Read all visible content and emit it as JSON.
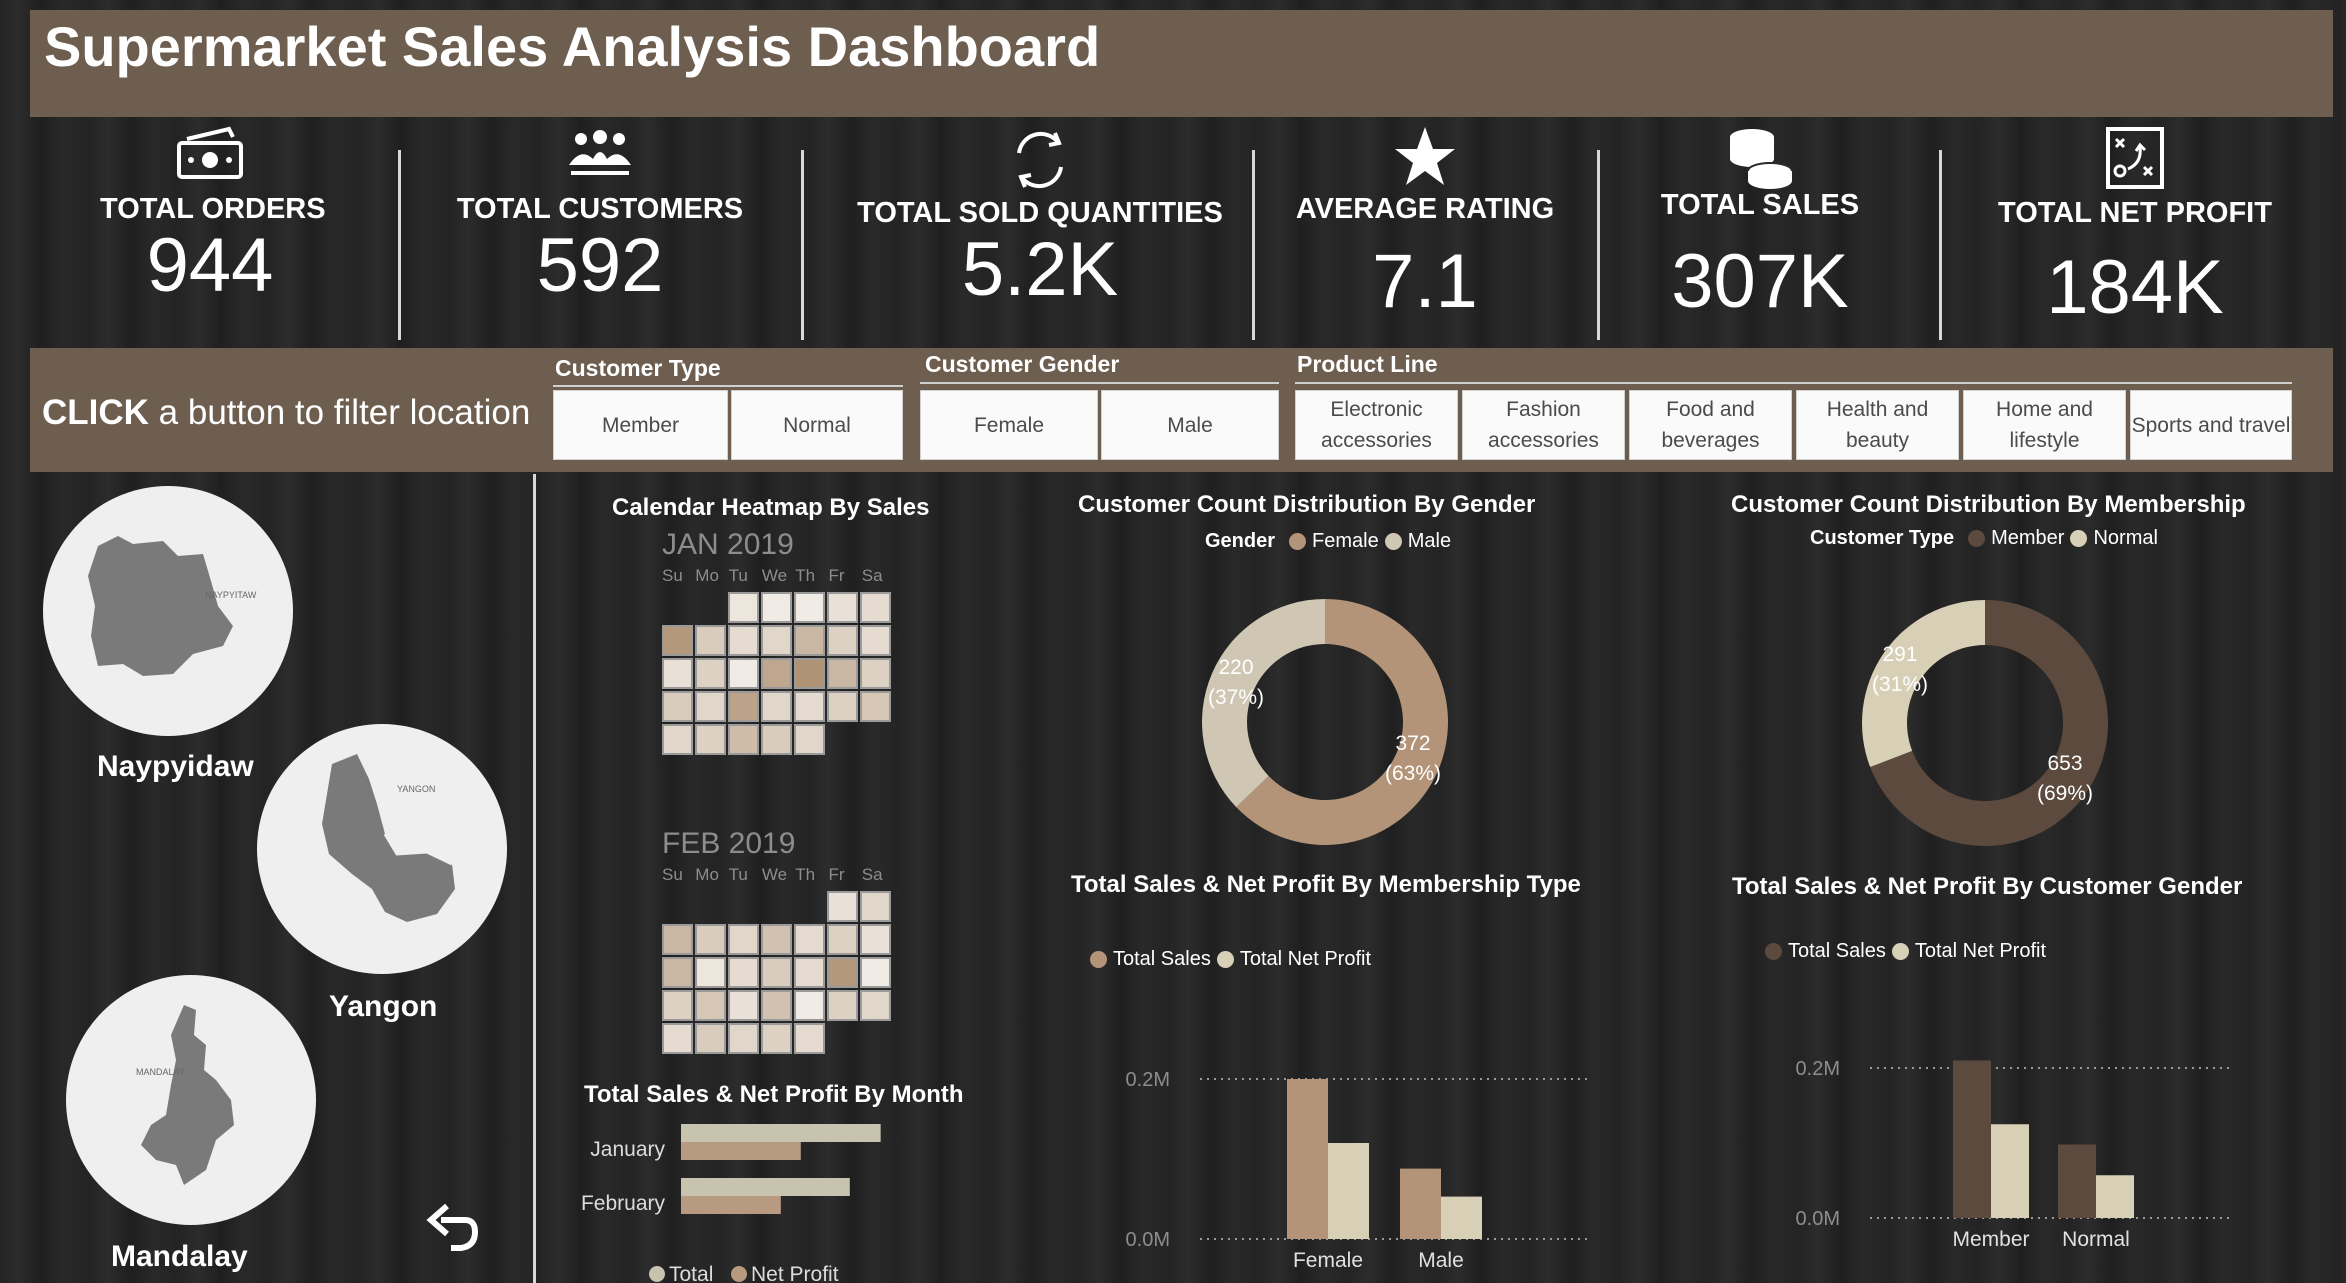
{
  "header": {
    "title": "Supermarket Sales Analysis Dashboard"
  },
  "kpis": [
    {
      "label": "TOTAL ORDERS",
      "value": "944",
      "icon": "cash-icon"
    },
    {
      "label": "TOTAL CUSTOMERS",
      "value": "592",
      "icon": "group-icon"
    },
    {
      "label": "TOTAL SOLD QUANTITIES",
      "value": "5.2K",
      "icon": "refresh-icon"
    },
    {
      "label": "AVERAGE RATING",
      "value": "7.1",
      "icon": "star-icon"
    },
    {
      "label": "TOTAL SALES",
      "value": "307K",
      "icon": "coins-icon"
    },
    {
      "label": "TOTAL NET PROFIT",
      "value": "184K",
      "icon": "strategy-icon"
    }
  ],
  "filters": {
    "click_bold": "CLICK",
    "click_rest": " a button to filter location",
    "customer_type": {
      "title": "Customer Type",
      "options": [
        "Member",
        "Normal"
      ]
    },
    "customer_gender": {
      "title": "Customer Gender",
      "options": [
        "Female",
        "Male"
      ]
    },
    "product_line": {
      "title": "Product Line",
      "options": [
        "Electronic accessories",
        "Fashion accessories",
        "Food and beverages",
        "Health and beauty",
        "Home and lifestyle",
        "Sports and travel"
      ]
    }
  },
  "locations": [
    {
      "name": "Naypyidaw",
      "map_label": "NAYPYITAW"
    },
    {
      "name": "Yangon",
      "map_label": "YANGON"
    },
    {
      "name": "Mandalay",
      "map_label": "MANDALAY"
    }
  ],
  "calendar": {
    "title": "Calendar Heatmap By Sales",
    "days_of_week": [
      "Su",
      "Mo",
      "Tu",
      "We",
      "Th",
      "Fr",
      "Sa"
    ],
    "months": [
      {
        "label": "JAN 2019",
        "start_weekday": 2,
        "days": 31,
        "intensity": [
          0.1,
          0.05,
          0.05,
          0.15,
          0.2,
          0.85,
          0.35,
          0.2,
          0.25,
          0.55,
          0.3,
          0.2,
          0.15,
          0.3,
          0.05,
          0.7,
          0.9,
          0.55,
          0.3,
          0.35,
          0.25,
          0.75,
          0.25,
          0.2,
          0.3,
          0.4,
          0.25,
          0.3,
          0.5,
          0.35,
          0.25
        ]
      },
      {
        "label": "FEB 2019",
        "start_weekday": 5,
        "days": 28,
        "intensity": [
          0.15,
          0.25,
          0.55,
          0.35,
          0.25,
          0.45,
          0.2,
          0.3,
          0.15,
          0.55,
          0.1,
          0.2,
          0.35,
          0.2,
          0.85,
          0.05,
          0.3,
          0.4,
          0.15,
          0.45,
          0.05,
          0.3,
          0.25,
          0.2,
          0.35,
          0.25,
          0.3,
          0.2
        ]
      }
    ]
  },
  "colors": {
    "member": "#5b4a3d",
    "normal": "#d8cfb7",
    "female": "#b39478",
    "male": "#cfc6b3",
    "total_sales_light": "#c7c3ae",
    "net_profit_tan": "#b89a80"
  },
  "chart_data": [
    {
      "type": "pie",
      "title": "Customer Count Distribution By Gender",
      "legend_title": "Gender",
      "categories": [
        "Female",
        "Male"
      ],
      "values": [
        372,
        220
      ],
      "labels": [
        "372 (63%)",
        "220 (37%)"
      ],
      "colors": [
        "#b39478",
        "#cfc6b3"
      ]
    },
    {
      "type": "pie",
      "title": "Customer Count Distribution By Membership",
      "legend_title": "Customer Type",
      "categories": [
        "Member",
        "Normal"
      ],
      "values": [
        653,
        291
      ],
      "labels": [
        "653 (69%)",
        "291 (31%)"
      ],
      "colors": [
        "#5b4a3d",
        "#d8cfb7"
      ]
    },
    {
      "type": "bar",
      "orientation": "horizontal",
      "title": "Total Sales & Net Profit By Month",
      "categories": [
        "January",
        "February"
      ],
      "series": [
        {
          "name": "Total",
          "values": [
            110000,
            93000
          ],
          "color": "#c7c3ae"
        },
        {
          "name": "Net Profit",
          "values": [
            66000,
            55000
          ],
          "color": "#b89a80"
        }
      ],
      "xlim": [
        0,
        200000
      ]
    },
    {
      "type": "bar",
      "title": "Total Sales & Net Profit By Membership Type",
      "categories": [
        "Female",
        "Male"
      ],
      "series": [
        {
          "name": "Total Sales",
          "values": [
            200000,
            88000
          ],
          "color": "#b39478"
        },
        {
          "name": "Total Net Profit",
          "values": [
            120000,
            53000
          ],
          "color": "#d8cfb7"
        }
      ],
      "ylim": [
        0,
        0.2
      ],
      "yticks": [
        "0.0M",
        "0.2M"
      ]
    },
    {
      "type": "bar",
      "title": "Total Sales & Net Profit By Customer Gender",
      "categories": [
        "Member",
        "Normal"
      ],
      "series": [
        {
          "name": "Total Sales",
          "values": [
            210000,
            98000
          ],
          "color": "#5b4a3d"
        },
        {
          "name": "Total Net Profit",
          "values": [
            125000,
            57000
          ],
          "color": "#d8cfb7"
        }
      ],
      "ylim": [
        0,
        0.2
      ],
      "yticks": [
        "0.0M",
        "0.2M"
      ]
    }
  ],
  "controls": {
    "undo_icon": "undo-arrow-icon"
  }
}
